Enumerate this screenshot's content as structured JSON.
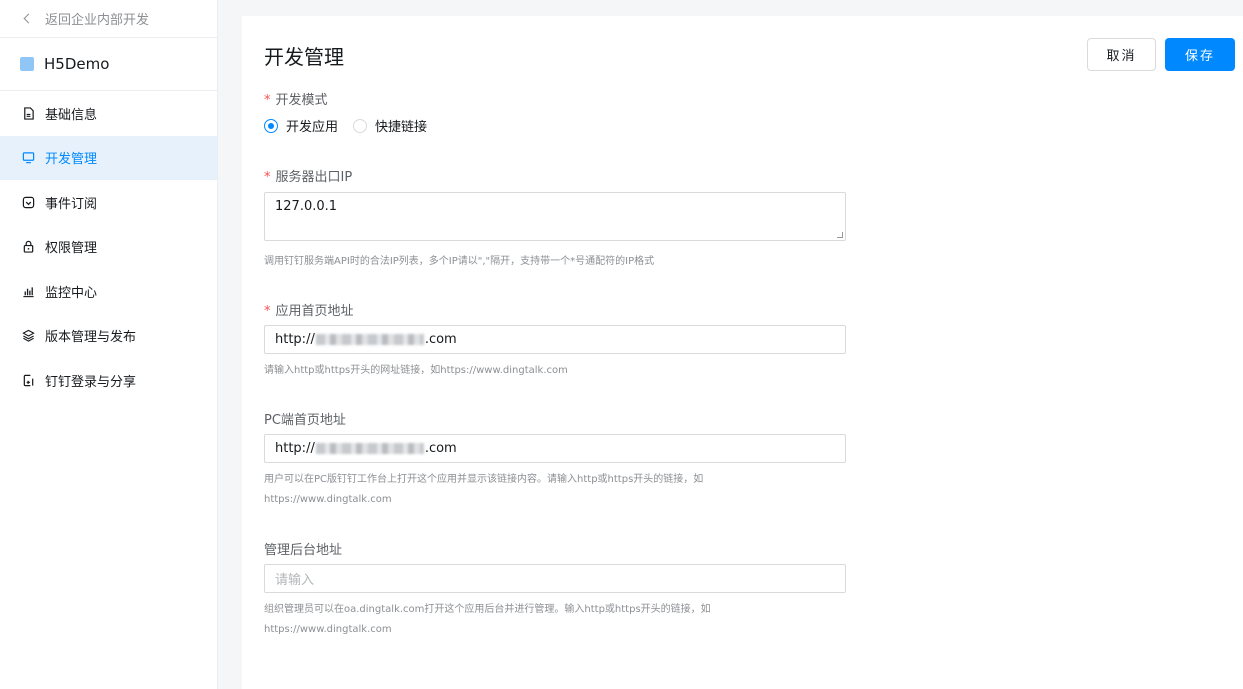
{
  "sidebar": {
    "back_label": "返回企业内部开发",
    "app_name": "H5Demo",
    "items": [
      {
        "label": "基础信息",
        "icon": "document-icon"
      },
      {
        "label": "开发管理",
        "icon": "monitor-icon"
      },
      {
        "label": "事件订阅",
        "icon": "subscription-icon"
      },
      {
        "label": "权限管理",
        "icon": "lock-icon"
      },
      {
        "label": "监控中心",
        "icon": "bar-chart-icon"
      },
      {
        "label": "版本管理与发布",
        "icon": "layers-icon"
      },
      {
        "label": "钉钉登录与分享",
        "icon": "login-share-icon"
      }
    ],
    "active_index": 1
  },
  "header": {
    "title": "开发管理",
    "cancel_label": "取消",
    "save_label": "保存"
  },
  "form": {
    "mode": {
      "label": "开发模式",
      "options": [
        "开发应用",
        "快捷链接"
      ],
      "selected": "开发应用"
    },
    "server_ip": {
      "label": "服务器出口IP",
      "value": "127.0.0.1",
      "help": "调用钉钉服务端API时的合法IP列表，多个IP请以\",\"隔开，支持带一个*号通配符的IP格式"
    },
    "home_url": {
      "label": "应用首页地址",
      "prefix": "http://",
      "suffix": ".com",
      "help": "请输入http或https开头的网址链接，如https://www.dingtalk.com"
    },
    "pc_url": {
      "label": "PC端首页地址",
      "prefix": "http://",
      "suffix": ".com",
      "help_line1": "用户可以在PC版钉钉工作台上打开这个应用并显示该链接内容。请输入http或https开头的链接，如",
      "help_line2": "https://www.dingtalk.com"
    },
    "admin_url": {
      "label": "管理后台地址",
      "placeholder": "请输入",
      "help_line1": "组织管理员可以在oa.dingtalk.com打开这个应用后台并进行管理。输入http或https开头的链接，如",
      "help_line2": "https://www.dingtalk.com"
    }
  },
  "colors": {
    "accent": "#0089ff",
    "active_bg": "#e6f1fc",
    "required": "#ff4d4f",
    "app_icon": "#8fc6f5"
  }
}
